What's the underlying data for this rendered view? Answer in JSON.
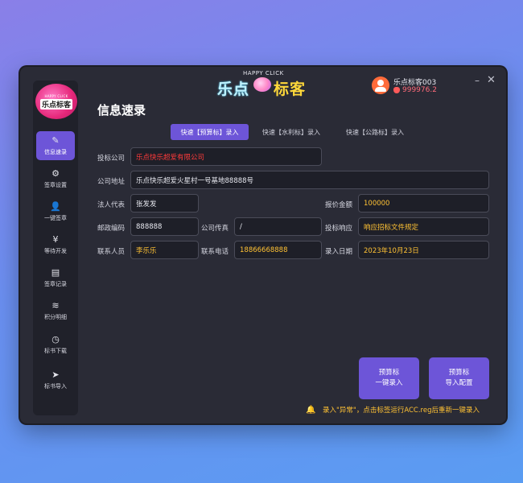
{
  "header": {
    "logo_sub": "HAPPY CLICK",
    "logo_left": "乐点",
    "logo_right": "标客",
    "username": "乐点标客003",
    "balance": "999976.2"
  },
  "sidebar": {
    "logo_tiny": "HAPPY CLICK",
    "logo_main": "乐点标客",
    "items": [
      {
        "label": "信息速录",
        "icon": "✎"
      },
      {
        "label": "签章设置",
        "icon": "⚙"
      },
      {
        "label": "一键签章",
        "icon": "👤"
      },
      {
        "label": "等待开发",
        "icon": "¥"
      },
      {
        "label": "签章记录",
        "icon": "▤"
      },
      {
        "label": "积分明细",
        "icon": "≋"
      },
      {
        "label": "标书下载",
        "icon": "◷"
      },
      {
        "label": "标书导入",
        "icon": "➤"
      }
    ]
  },
  "main": {
    "title": "信息速录",
    "tabs": [
      "快速【预算标】录入",
      "快速【水利标】录入",
      "快速【公路标】录入"
    ],
    "form": {
      "bid_company_label": "投标公司",
      "bid_company": "乐点快乐超爱有限公司",
      "address_label": "公司地址",
      "address": "乐点快乐超爱火星村一号基地88888号",
      "legal_rep_label": "法人代表",
      "legal_rep": "张发发",
      "quote_label": "报价金额",
      "quote": "100000",
      "postcode_label": "邮政编码",
      "postcode": "888888",
      "fax_label": "公司传真",
      "fax": "/",
      "response_label": "投标响应",
      "response": "响应招标文件规定",
      "contact_label": "联系人员",
      "contact": "李乐乐",
      "phone_label": "联系电话",
      "phone": "18866668888",
      "date_label": "录入日期",
      "date": "2023年10月23日"
    },
    "btn1_line1": "预算标",
    "btn1_line2": "一键录入",
    "btn2_line1": "预算标",
    "btn2_line2": "导入配置",
    "notice": "录入\"异常\"，点击标签运行ACC.reg后重新一键录入"
  },
  "colors": {
    "accent": "#6d55d8",
    "window": "#2a2b36",
    "gold": "#ffc234",
    "red": "#ff3a3a"
  }
}
